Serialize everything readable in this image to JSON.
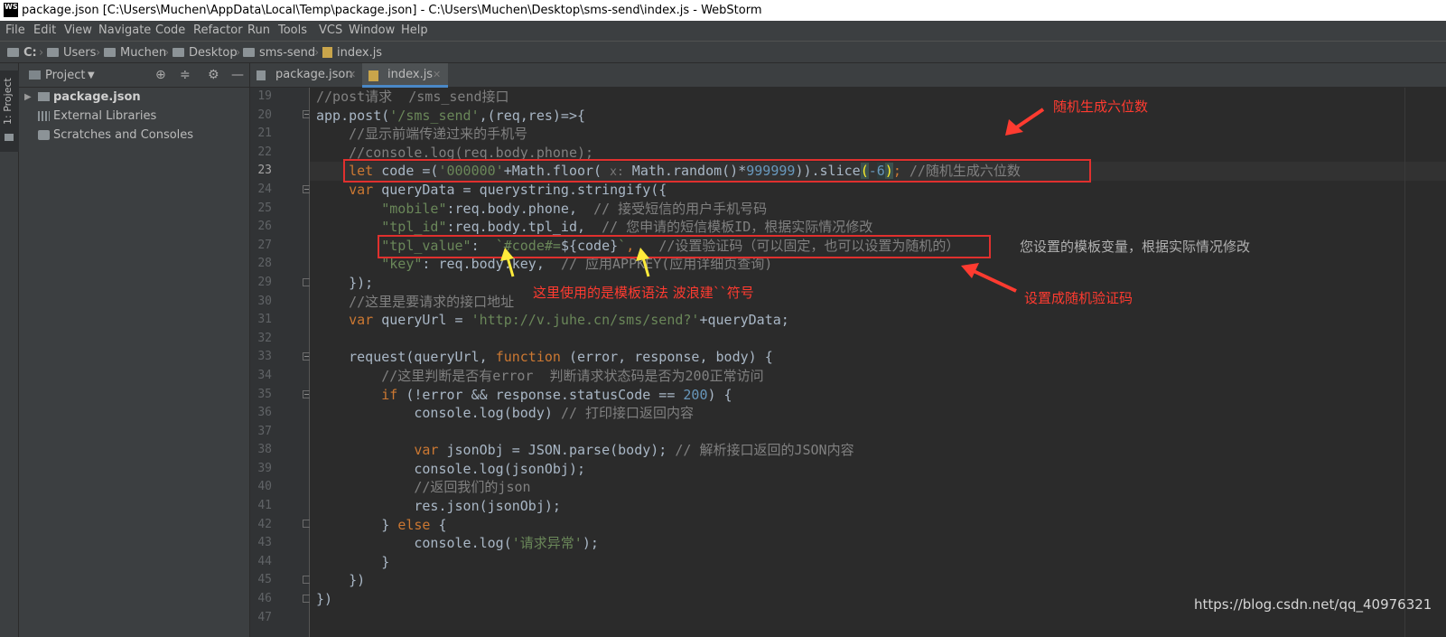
{
  "window": {
    "logo": "WS",
    "title": "package.json [C:\\Users\\Muchen\\AppData\\Local\\Temp\\package.json] - C:\\Users\\Muchen\\Desktop\\sms-send\\index.js - WebStorm"
  },
  "menu": [
    "File",
    "Edit",
    "View",
    "Navigate",
    "Code",
    "Refactor",
    "Run",
    "Tools",
    "VCS",
    "Window",
    "Help"
  ],
  "breadcrumbs": [
    "C:",
    "Users",
    "Muchen",
    "Desktop",
    "sms-send",
    "index.js"
  ],
  "sidebar_stripe": {
    "label": "1: Project"
  },
  "project_panel": {
    "title": "Project",
    "tree": [
      {
        "label": "package.json"
      },
      {
        "label": "External Libraries"
      },
      {
        "label": "Scratches and Consoles"
      }
    ]
  },
  "editor_tabs": [
    {
      "label": "package.json",
      "active": false
    },
    {
      "label": "index.js",
      "active": true
    }
  ],
  "line_numbers": [
    "19",
    "20",
    "21",
    "22",
    "23",
    "24",
    "25",
    "26",
    "27",
    "28",
    "29",
    "30",
    "31",
    "32",
    "33",
    "34",
    "35",
    "36",
    "37",
    "38",
    "39",
    "40",
    "41",
    "42",
    "43",
    "44",
    "45",
    "46",
    "47"
  ],
  "current_line": "23",
  "code": {
    "l19": {
      "c1": "//post请求  /sms_send接口"
    },
    "l20": {
      "a": "app.post(",
      "b": "'/sms_send'",
      "c": ",(req,res)=>{"
    },
    "l21": {
      "c1": "    //显示前端传递过来的手机号"
    },
    "l22": {
      "c1": "    //console.log(req.body.phone);"
    },
    "l23": {
      "indent": "    ",
      "kw": "let",
      "a": " code =(",
      "s": "'000000'",
      "b": "+Math.floor( ",
      "hint": "x:",
      "c": " Math.random()*",
      "n": "999999",
      "d": ")).slice",
      "p1": "(",
      "m": "-",
      "six": "6",
      "p2": ")",
      "semi": ";",
      "cm": " //随机生成六位数"
    },
    "l24": {
      "indent": "    ",
      "kw": "var",
      "a": " queryData = querystring.stringify({"
    },
    "l25": {
      "indent": "        ",
      "s": "\"mobile\"",
      "a": ":req.body.phone,  ",
      "cm": "// 接受短信的用户手机号码"
    },
    "l26": {
      "indent": "        ",
      "s": "\"tpl_id\"",
      "a": ":req.body.tpl_id,  ",
      "cm": "// 您申请的短信模板ID，根据实际情况修改"
    },
    "l27": {
      "indent": "        ",
      "s": "\"tpl_value\"",
      "a": ":  ",
      "s2": "`#code#=",
      "ph": "${code}",
      "s3": "`",
      "b": ",   ",
      "cm": "//设置验证码（可以固定，也可以设置为随机的）"
    },
    "l28": {
      "indent": "        ",
      "s": "\"key\"",
      "a": ": req.body.key,  ",
      "cm": "// 应用APPKEY(应用详细页查询)"
    },
    "l29": {
      "a": "    });"
    },
    "l30": {
      "c1": "    //这里是要请求的接口地址"
    },
    "l31": {
      "indent": "    ",
      "kw": "var",
      "a": " queryUrl = ",
      "s": "'http://v.juhe.cn/sms/send?'",
      "b": "+queryData;"
    },
    "l32": {
      "a": ""
    },
    "l33": {
      "indent": "    ",
      "a": "request(queryUrl, ",
      "kw": "function",
      "b": " (error, response, body) {"
    },
    "l34": {
      "c1": "        //这里判断是否有error  判断请求状态码是否为200正常访问"
    },
    "l35": {
      "indent": "        ",
      "kw": "if",
      "a": " (!error && response.statusCode == ",
      "n": "200",
      "b": ") {"
    },
    "l36": {
      "indent": "            ",
      "a": "console.log(body) ",
      "cm": "// 打印接口返回内容"
    },
    "l37": {
      "a": ""
    },
    "l38": {
      "indent": "            ",
      "kw": "var",
      "a": " jsonObj = JSON.parse(body); ",
      "cm": "// 解析接口返回的JSON内容"
    },
    "l39": {
      "a": "            console.log(jsonObj);"
    },
    "l40": {
      "c1": "            //返回我们的json"
    },
    "l41": {
      "a": "            res.json(jsonObj);"
    },
    "l42": {
      "indent": "        ",
      "a": "} ",
      "kw": "else",
      "b": " {"
    },
    "l43": {
      "indent": "            ",
      "a": "console.log(",
      "s": "'请求异常'",
      "b": ");"
    },
    "l44": {
      "a": "        }"
    },
    "l45": {
      "a": "    })"
    },
    "l46": {
      "a": "})"
    },
    "l47": {
      "a": ""
    }
  },
  "annotations": {
    "random_six": "随机生成六位数",
    "template_var_note": "您设置的模板变量，根据实际情况修改",
    "template_syntax_note": "这里使用的是模板语法 波浪建``符号",
    "random_code_note": "设置成随机验证码"
  },
  "watermark": "https://blog.csdn.net/qq_40976321",
  "colors": {
    "annotation_red": "#ff3b30",
    "arrow_yellow": "#ffeb3b",
    "editor_bg": "#2b2b2b",
    "panel_bg": "#3c3f41"
  }
}
